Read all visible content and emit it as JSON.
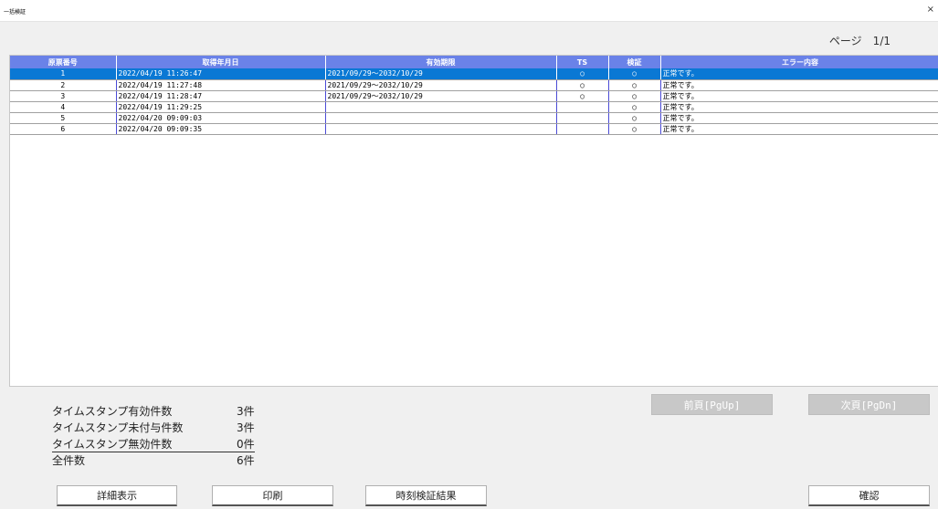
{
  "window": {
    "title": "一括検証",
    "close_glyph": "×"
  },
  "page_indicator": "ページ　1/1",
  "table": {
    "columns": [
      "原票番号",
      "取得年月日",
      "有効期限",
      "TS",
      "検証",
      "エラー内容"
    ],
    "rows": [
      {
        "no": "1",
        "date": "2022/04/19 11:26:47",
        "period": "2021/09/29～2032/10/29",
        "ts": "○",
        "verify": "○",
        "error": "正常です。",
        "selected": true
      },
      {
        "no": "2",
        "date": "2022/04/19 11:27:48",
        "period": "2021/09/29～2032/10/29",
        "ts": "○",
        "verify": "○",
        "error": "正常です。",
        "selected": false
      },
      {
        "no": "3",
        "date": "2022/04/19 11:28:47",
        "period": "2021/09/29～2032/10/29",
        "ts": "○",
        "verify": "○",
        "error": "正常です。",
        "selected": false
      },
      {
        "no": "4",
        "date": "2022/04/19 11:29:25",
        "period": "",
        "ts": "",
        "verify": "○",
        "error": "正常です。",
        "selected": false
      },
      {
        "no": "5",
        "date": "2022/04/20 09:09:03",
        "period": "",
        "ts": "",
        "verify": "○",
        "error": "正常です。",
        "selected": false
      },
      {
        "no": "6",
        "date": "2022/04/20 09:09:35",
        "period": "",
        "ts": "",
        "verify": "○",
        "error": "正常です。",
        "selected": false
      }
    ]
  },
  "summary": {
    "valid_label": "タイムスタンプ有効件数",
    "valid_count": "3件",
    "unassigned_label": "タイムスタンプ未付与件数",
    "unassigned_count": "3件",
    "invalid_label": "タイムスタンプ無効件数",
    "invalid_count": "0件",
    "total_label": "全件数",
    "total_count": "6件"
  },
  "buttons": {
    "prev": "前頁[PgUp]",
    "next": "次頁[PgDn]",
    "detail": "詳細表示",
    "print": "印刷",
    "time_verify": "時刻検証結果",
    "confirm": "確認"
  },
  "colors": {
    "header_bg": "#6a82e8",
    "selected_row": "#0a78d4",
    "column_border": "#4b4bd6",
    "disabled_button": "#c8c8c8"
  }
}
